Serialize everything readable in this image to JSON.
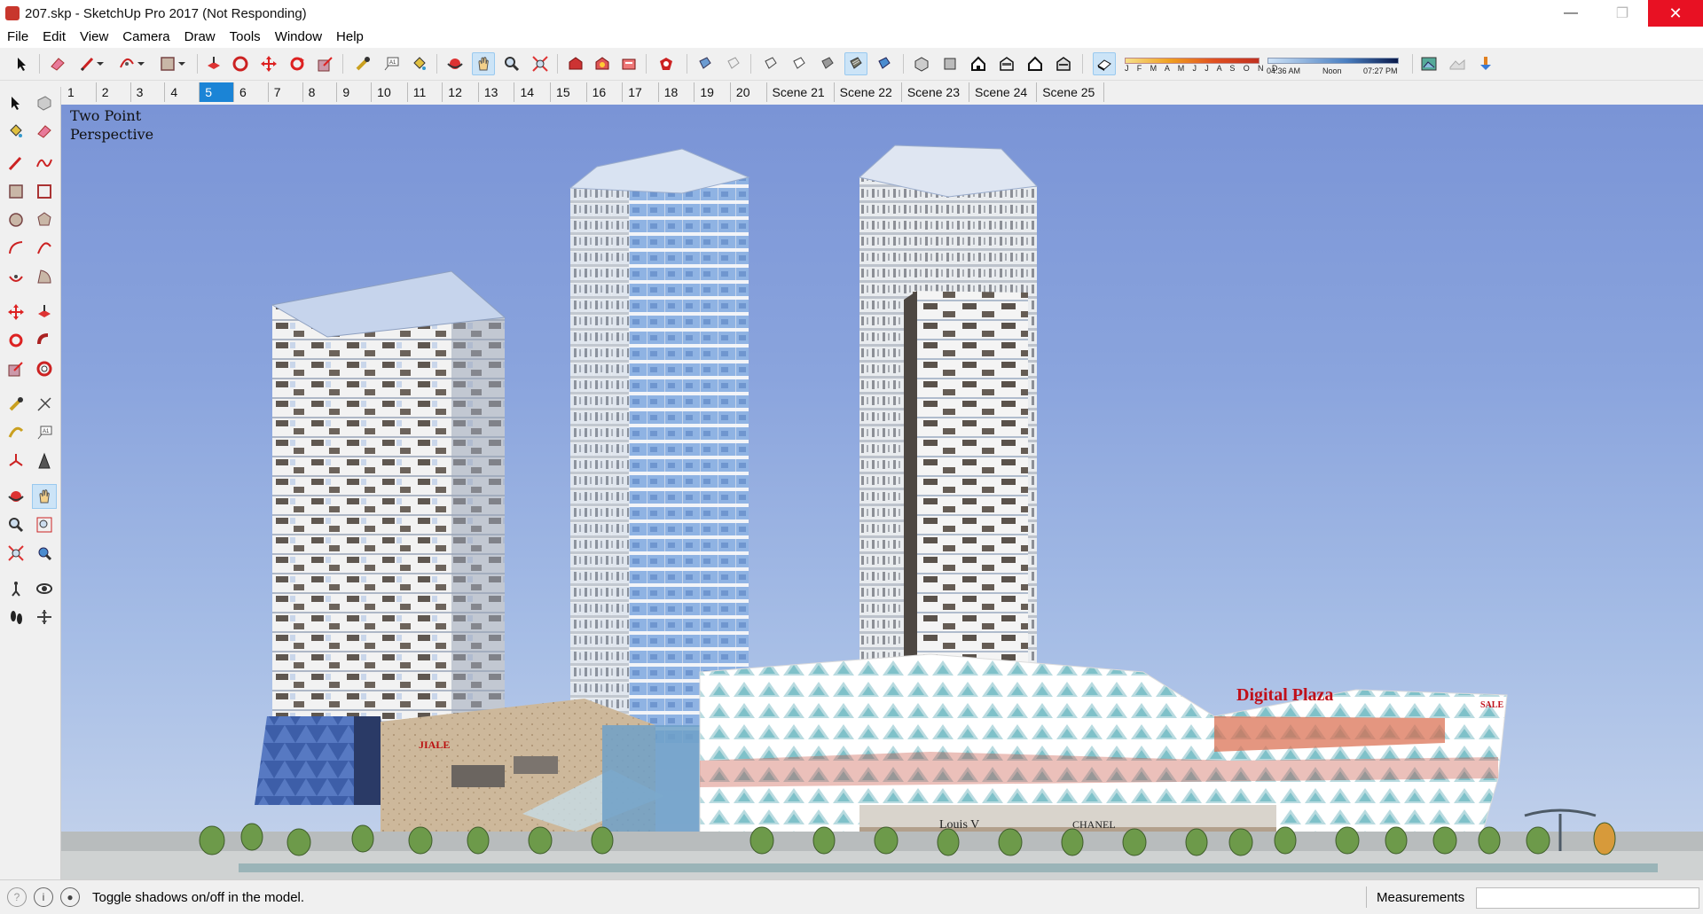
{
  "window": {
    "title": "207.skp - SketchUp Pro 2017 (Not Responding)",
    "minimize": "—",
    "maximize": "❐",
    "close": "✕"
  },
  "menu": [
    "File",
    "Edit",
    "View",
    "Camera",
    "Draw",
    "Tools",
    "Window",
    "Help"
  ],
  "shadow_settings": {
    "months": "J F M A M J J A S O N D",
    "time_start": "04:36 AM",
    "time_mid": "Noon",
    "time_end": "07:27 PM"
  },
  "scenes": {
    "active_index": 4,
    "tabs": [
      "1",
      "2",
      "3",
      "4",
      "5",
      "6",
      "7",
      "8",
      "9",
      "10",
      "11",
      "12",
      "13",
      "14",
      "15",
      "16",
      "17",
      "18",
      "19",
      "20",
      "Scene 21",
      "Scene 22",
      "Scene 23",
      "Scene 24",
      "Scene 25"
    ]
  },
  "viewport": {
    "camera_label_line1": "Two Point",
    "camera_label_line2": "Perspective",
    "signs": {
      "digital_plaza": "Digital Plaza",
      "jiale": "JIALE",
      "sale": "SALE",
      "louis": "Louis V",
      "chanel": "CHANEL"
    }
  },
  "status": {
    "text": "Toggle shadows on/off in the model.",
    "measurements_label": "Measurements",
    "measurements_value": ""
  },
  "colors": {
    "accent": "#1b84d6",
    "close_red": "#e81123",
    "sky_top": "#7a94d6"
  }
}
